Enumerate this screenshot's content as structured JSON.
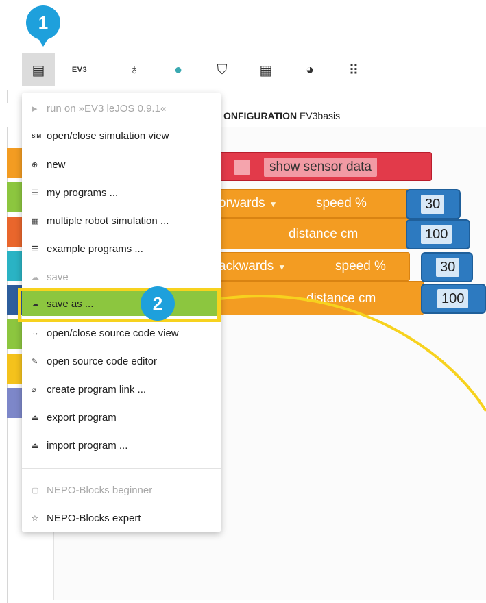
{
  "callouts": {
    "one": "1",
    "two": "2"
  },
  "toolbar": {
    "items": [
      {
        "name": "program-menu-icon",
        "glyph": "▤"
      },
      {
        "name": "ev3-robot-button",
        "label": "EV3"
      },
      {
        "name": "help-lightbulb-icon",
        "glyph": "💡"
      },
      {
        "name": "user-icon",
        "glyph": "👤"
      },
      {
        "name": "gallery-graduation-cap-icon",
        "glyph": "🎓"
      },
      {
        "name": "grid-apps-icon",
        "glyph": "▦"
      },
      {
        "name": "globe-icon",
        "glyph": "🌍"
      },
      {
        "name": "more-dots-icon",
        "glyph": "⠿"
      }
    ]
  },
  "tab": {
    "bold": "ONFIGURATION",
    "name": "EV3basis"
  },
  "menu": {
    "items": [
      {
        "icon": "▶",
        "label": "run on »EV3 leJOS 0.9.1«",
        "disabled": true
      },
      {
        "icon": "SIM",
        "label": "open/close simulation view"
      },
      {
        "icon": "⊕",
        "label": "new"
      },
      {
        "icon": "☰",
        "label": "my programs ..."
      },
      {
        "icon": "▦",
        "label": "multiple robot simulation ..."
      },
      {
        "icon": "☰",
        "label": "example programs ..."
      },
      {
        "icon": "☁",
        "label": "save",
        "disabled": true
      },
      {
        "icon": "☁",
        "label": "save as ...",
        "highlight": true
      },
      {
        "icon": "↔",
        "label": "open/close source code view"
      },
      {
        "icon": "✎",
        "label": "open source code editor"
      },
      {
        "icon": "⌀",
        "label": "create program link ..."
      },
      {
        "icon": "⏏",
        "label": "export program"
      },
      {
        "icon": "⏏",
        "label": "import program ..."
      },
      {
        "icon": "▢",
        "label": "NEPO-Blocks beginner",
        "disabled": true
      },
      {
        "icon": "☆",
        "label": "NEPO-Blocks expert"
      }
    ]
  },
  "blocks": {
    "show_sensor_label": "show sensor data",
    "move1_dir": "orwards",
    "move2_dir": "ackwards",
    "speed_label": "speed %",
    "distance_label": "distance cm",
    "speed1": "30",
    "distance1": "100",
    "speed2": "30",
    "distance2": "100"
  },
  "categories": {
    "colors": [
      "#f39c22",
      "#8cc63f",
      "#e9662c",
      "#2ab3c4",
      "#2d5d9c",
      "#8cc63f",
      "#f4c21c",
      "#7d87c9"
    ]
  },
  "colors": {
    "highlight": "#8cc63f",
    "callout": "#1ea0dc",
    "frame": "#f7d21e"
  }
}
